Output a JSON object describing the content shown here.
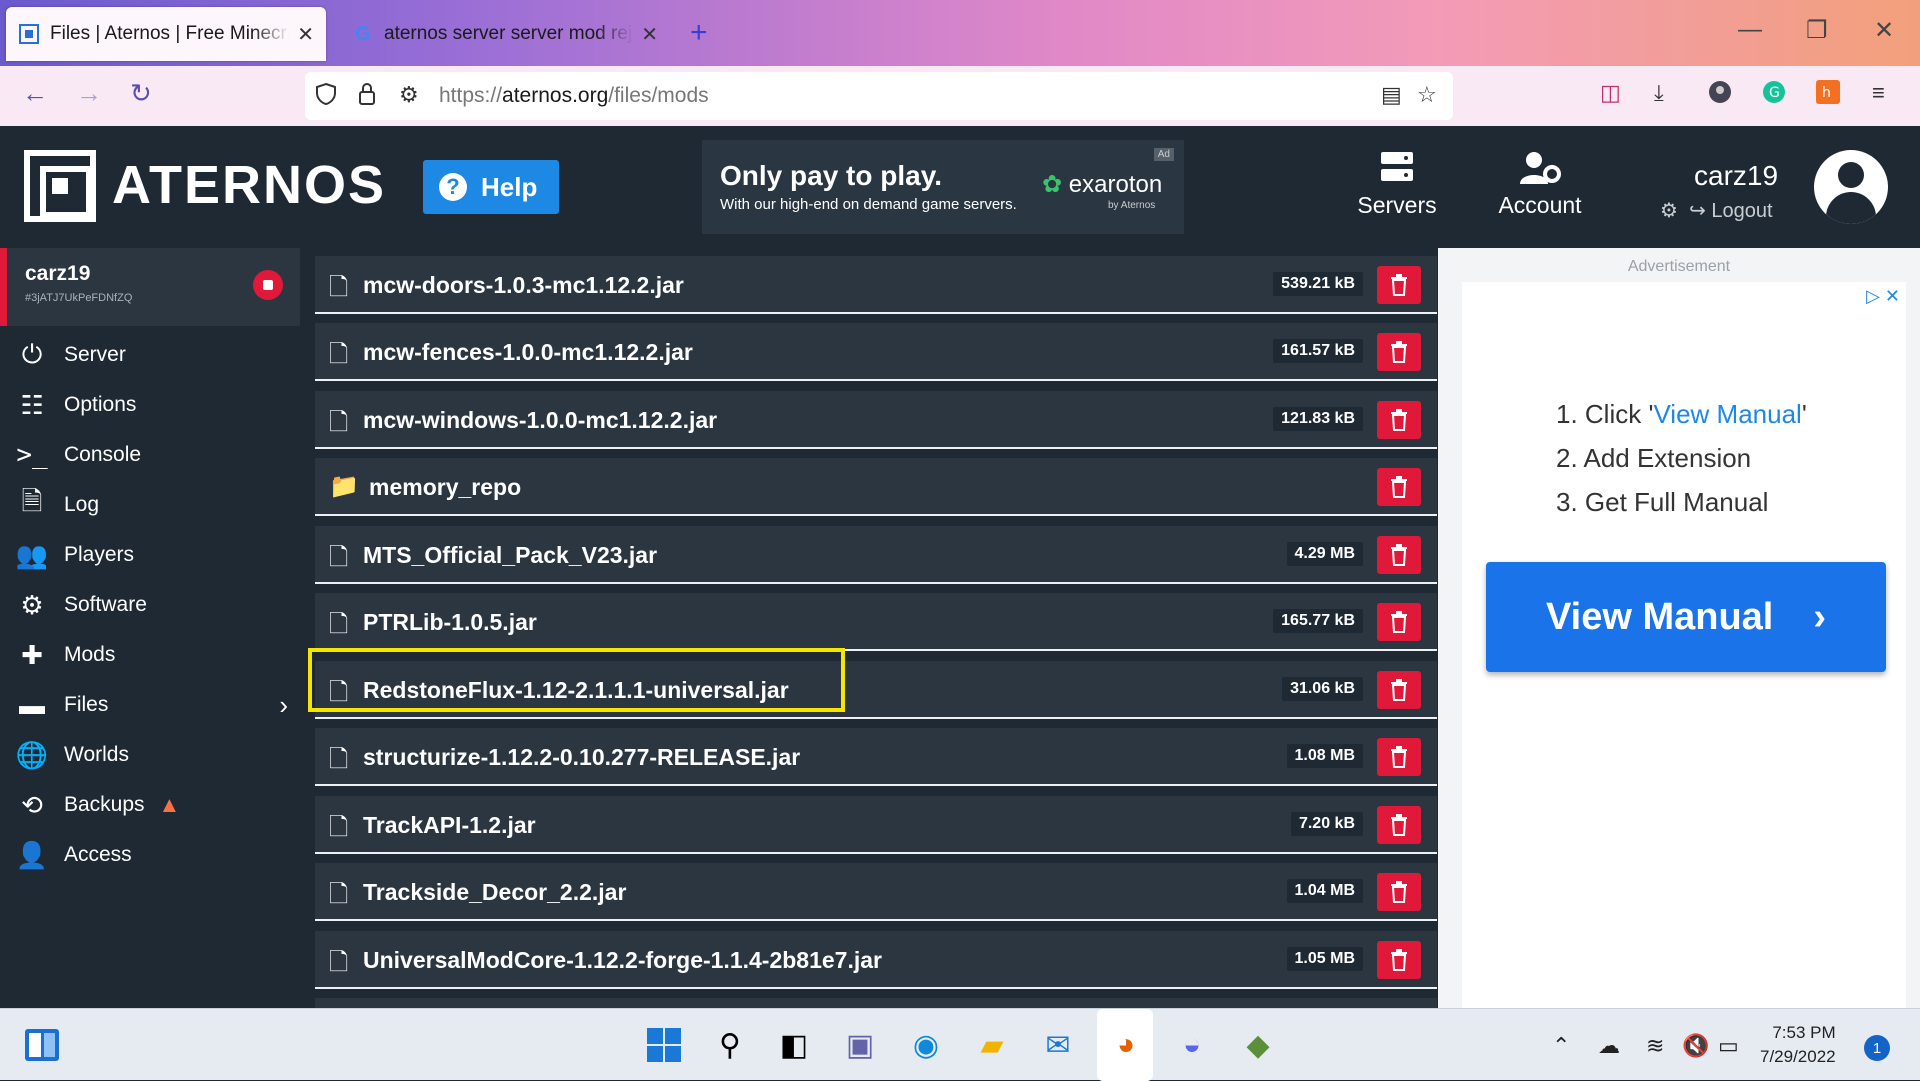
{
  "browser": {
    "tabs": [
      {
        "title": "Files | Aternos | Free Minecraft Server",
        "active": true
      },
      {
        "title": "aternos server server mod rejected",
        "active": false
      }
    ],
    "url_prefix": "https://",
    "url_host": "aternos.org",
    "url_path": "/files/mods"
  },
  "header": {
    "logo": "ATERNOS",
    "help_label": "Help",
    "ad_title": "Only pay to play.",
    "ad_subtitle": "With our high-end on demand game servers.",
    "ad_brand": "exaroton",
    "ad_brand_by": "by Aternos",
    "ad_tag": "Ad",
    "nav": [
      {
        "label": "Servers",
        "icon": "servers-icon"
      },
      {
        "label": "Account",
        "icon": "account-icon"
      }
    ],
    "username": "carz19",
    "logout_label": "Logout"
  },
  "sidebar": {
    "server_name": "carz19",
    "server_id": "#3jATJ7UkPeFDNfZQ",
    "items": [
      {
        "label": "Server",
        "icon": "power-icon"
      },
      {
        "label": "Options",
        "icon": "options-icon"
      },
      {
        "label": "Console",
        "icon": "console-icon"
      },
      {
        "label": "Log",
        "icon": "log-icon"
      },
      {
        "label": "Players",
        "icon": "players-icon"
      },
      {
        "label": "Software",
        "icon": "software-icon"
      },
      {
        "label": "Mods",
        "icon": "mods-icon"
      },
      {
        "label": "Files",
        "icon": "files-icon"
      },
      {
        "label": "Worlds",
        "icon": "worlds-icon"
      },
      {
        "label": "Backups",
        "icon": "backups-icon"
      },
      {
        "label": "Access",
        "icon": "access-icon"
      }
    ]
  },
  "files": [
    {
      "name": "mcw-doors-1.0.3-mc1.12.2.jar",
      "size": "539.21 kB",
      "type": "file"
    },
    {
      "name": "mcw-fences-1.0.0-mc1.12.2.jar",
      "size": "161.57 kB",
      "type": "file"
    },
    {
      "name": "mcw-windows-1.0.0-mc1.12.2.jar",
      "size": "121.83 kB",
      "type": "file"
    },
    {
      "name": "memory_repo",
      "size": "",
      "type": "folder"
    },
    {
      "name": "MTS_Official_Pack_V23.jar",
      "size": "4.29 MB",
      "type": "file"
    },
    {
      "name": "PTRLib-1.0.5.jar",
      "size": "165.77 kB",
      "type": "file"
    },
    {
      "name": "RedstoneFlux-1.12-2.1.1.1-universal.jar",
      "size": "31.06 kB",
      "type": "file"
    },
    {
      "name": "structurize-1.12.2-0.10.277-RELEASE.jar",
      "size": "1.08 MB",
      "type": "file"
    },
    {
      "name": "TrackAPI-1.2.jar",
      "size": "7.20 kB",
      "type": "file"
    },
    {
      "name": "Trackside_Decor_2.2.jar",
      "size": "1.04 MB",
      "type": "file"
    },
    {
      "name": "UniversalModCore-1.12.2-forge-1.1.4-2b81e7.jar",
      "size": "1.05 MB",
      "type": "file"
    }
  ],
  "ad": {
    "label": "Advertisement",
    "step1_prefix": "1. Click '",
    "step1_link": "View Manual",
    "step1_suffix": "'",
    "step2": "2. Add Extension",
    "step3": "3. Get Full Manual",
    "button": "View Manual"
  },
  "taskbar": {
    "time": "7:53 PM",
    "date": "7/29/2022",
    "notifications": "1"
  },
  "colors": {
    "accent": "#1e88e5",
    "danger": "#e0193a",
    "highlight": "#f5e600",
    "panel": "#2b3640",
    "bg": "#1f2933"
  }
}
